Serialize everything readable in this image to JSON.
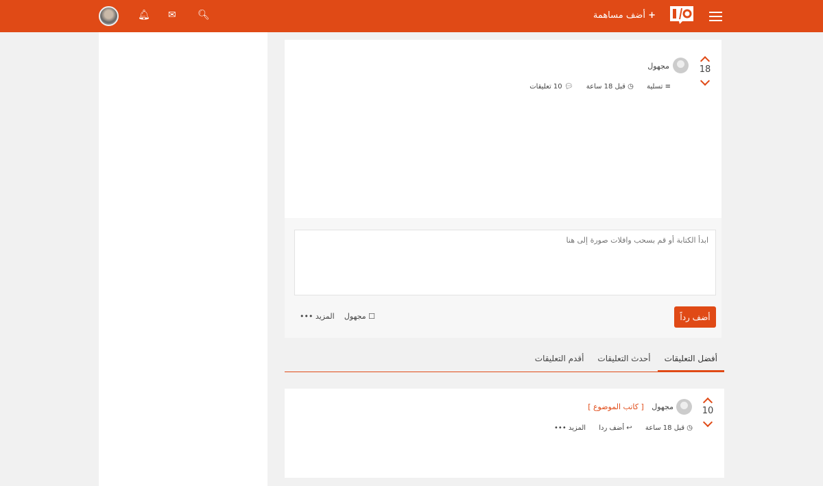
{
  "header": {
    "add_contribution": "أضف مساهمة",
    "logo_text": "I/O",
    "icons": [
      "menu-icon",
      "search-icon",
      "envelope-icon",
      "bell-icon",
      "avatar"
    ]
  },
  "post": {
    "votes": "18",
    "author": "مجهول",
    "category": "تسلية",
    "time": "قبل 18 ساعة",
    "comments": "10 تعليقات"
  },
  "compose": {
    "placeholder": "ابدأ الكتابة أو قم بسحب وافلات صورة إلى هنا",
    "anonymous_label": "مجهول",
    "more_label": "المزيد •••",
    "submit_label": "أضف رداً"
  },
  "tabs": [
    {
      "label": "أفضل التعليقات",
      "active": true
    },
    {
      "label": "أحدث التعليقات"
    },
    {
      "label": "أقدم التعليقات"
    }
  ],
  "comment": {
    "votes": "10",
    "author": "مجهول",
    "author_badge": "[ كاتب الموضوع ]",
    "time": "قبل 18 ساعة",
    "reply": "أضف ردا",
    "more": "المزيد •••"
  },
  "colors": {
    "accent": "#e04a16"
  }
}
